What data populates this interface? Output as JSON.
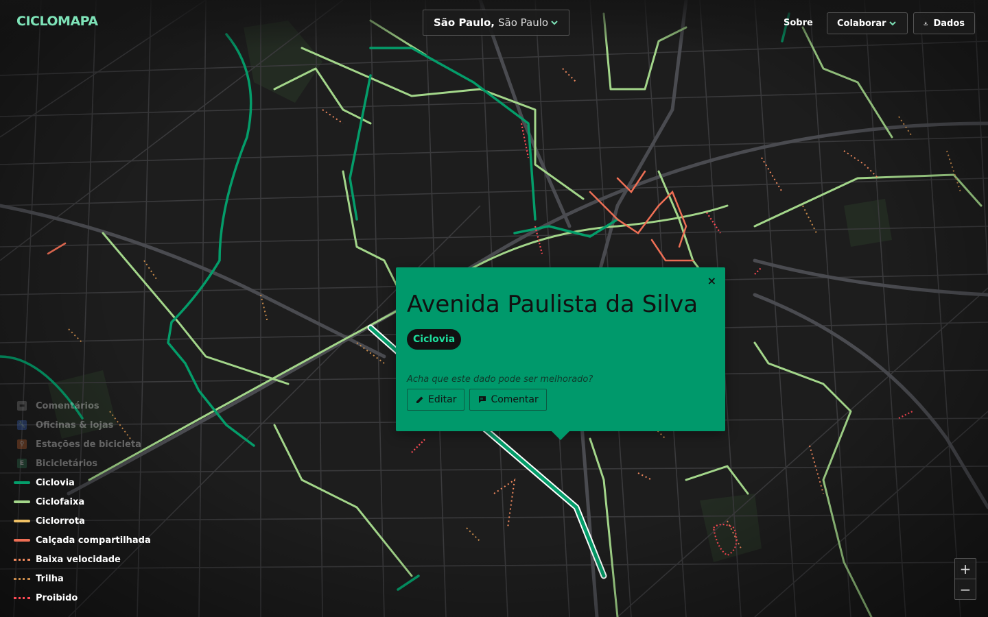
{
  "brand": {
    "logo": "CICLOMAPA",
    "accent": "#00996b",
    "logo_color": "#7ee3b8"
  },
  "header": {
    "city": "São Paulo,",
    "state": "São Paulo",
    "city_icon": "chevron-down-icon",
    "about_label": "Sobre",
    "collaborate_label": "Colaborar",
    "collaborate_icon": "chevron-down-icon",
    "data_label": "Dados",
    "data_icon": "download-icon"
  },
  "popup": {
    "close_label": "×",
    "title": "Avenida Paulista da Silva",
    "type": "Ciclovia",
    "question": "Acha que este dado pode ser melhorado?",
    "edit_label": "Editar",
    "edit_icon": "pencil-icon",
    "comment_label": "Comentar",
    "comment_icon": "comment-icon"
  },
  "legend": {
    "items": [
      {
        "label": "Comentários",
        "icon": "comment-icon",
        "color": "#8a8a8a",
        "dim": true
      },
      {
        "label": "Oficinas & lojas",
        "icon": "wrench-icon",
        "color": "#3a66c4",
        "dim": true
      },
      {
        "label": "Estações de bicicleta",
        "icon": "bike-share-icon",
        "color": "#c8642e",
        "dim": true
      },
      {
        "label": "Bicicletários",
        "icon": "parking-icon",
        "color": "#2e7a55",
        "dim": true
      },
      {
        "label": "Ciclovia",
        "icon": "solid-line",
        "color": "#049d6a",
        "dim": false
      },
      {
        "label": "Ciclofaixa",
        "icon": "solid-line",
        "color": "#a3d68a",
        "dim": false
      },
      {
        "label": "Ciclorrota",
        "icon": "solid-line",
        "color": "#f0c165",
        "dim": false
      },
      {
        "label": "Calçada compartilhada",
        "icon": "solid-line",
        "color": "#ef6f55",
        "dim": false
      },
      {
        "label": "Baixa velocidade",
        "icon": "dotted-line",
        "color": "#f28a5e",
        "dim": false
      },
      {
        "label": "Trilha",
        "icon": "dotted-line",
        "color": "#c98b4b",
        "dim": false
      },
      {
        "label": "Proibido",
        "icon": "dotted-line",
        "color": "#ff4a55",
        "dim": false
      }
    ]
  },
  "zoom": {
    "in_label": "+",
    "out_label": "−"
  }
}
